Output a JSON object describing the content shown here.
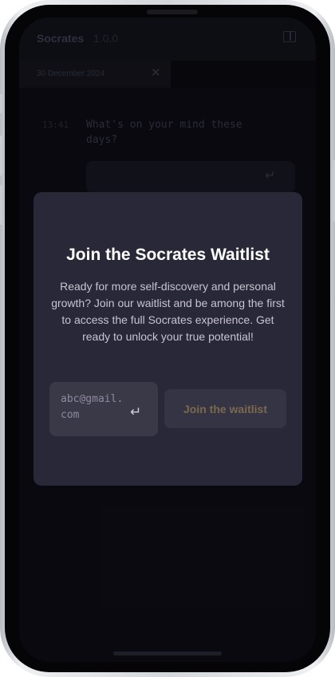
{
  "app": {
    "name": "Socrates",
    "version": "1.0.0",
    "icons": {
      "sidebar_toggle": "sidebar-panel-icon"
    }
  },
  "tab": {
    "date": "30 December 2024",
    "close_glyph": "✕"
  },
  "chat": {
    "time": "13:41",
    "question": "What's on your mind these days?",
    "enter_glyph": "↵"
  },
  "modal": {
    "title": "Join the Socrates Waitlist",
    "description": "Ready for more self-discovery and personal growth? Join our waitlist and be among the first to access the full Socrates experience. Get ready to unlock your true potential!",
    "email_placeholder": "abc@gmail.com",
    "enter_glyph": "↵",
    "button_label": "Join the waitlist"
  },
  "colors": {
    "modal_background": "#292838",
    "button_text": "#7a6a4c",
    "screen_background": "#0d0d15"
  }
}
